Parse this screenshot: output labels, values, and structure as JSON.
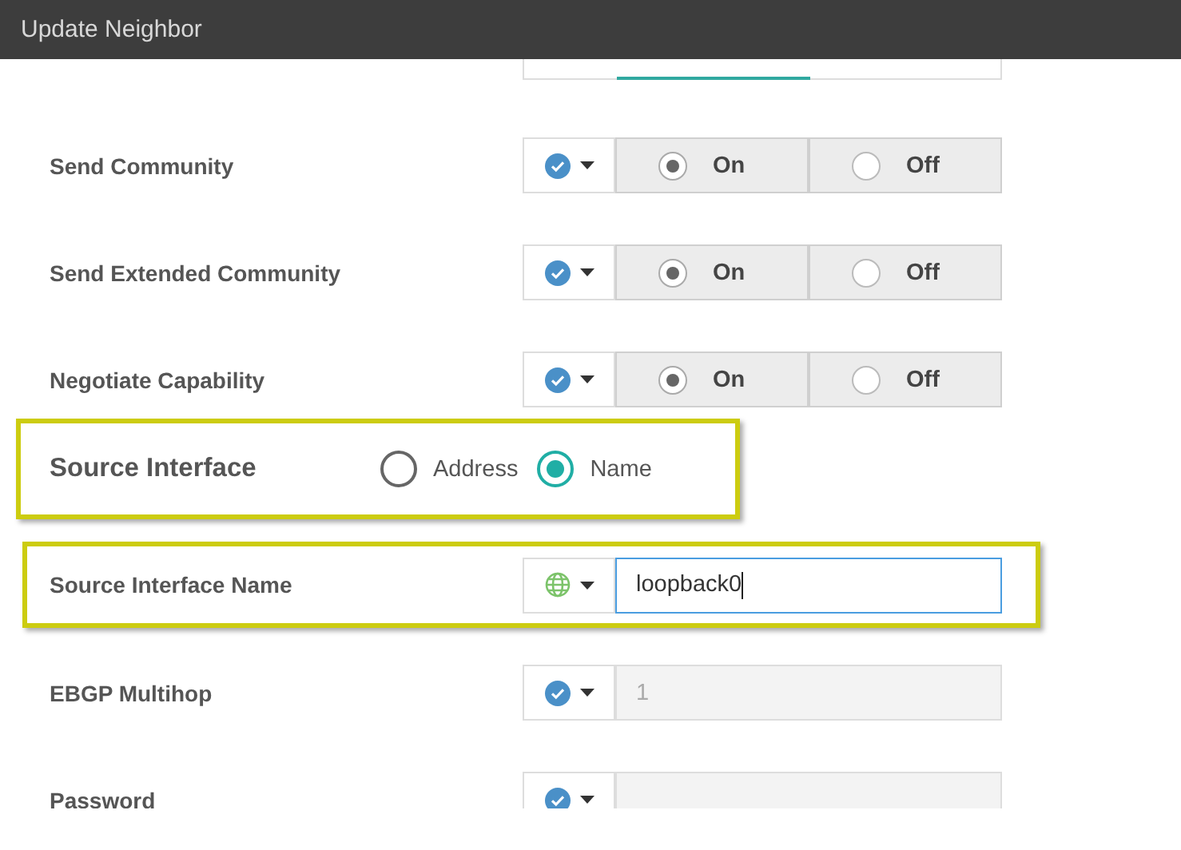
{
  "window": {
    "title": "Update Neighbor"
  },
  "rows": [
    {
      "kind": "cut_field"
    },
    {
      "kind": "toggle",
      "label": "Send Community",
      "mode": {
        "kind": "check"
      },
      "options": [
        {
          "label": "On",
          "selected": true
        },
        {
          "label": "Off",
          "selected": false
        }
      ]
    },
    {
      "kind": "toggle",
      "label": "Send Extended Community",
      "mode": {
        "kind": "check"
      },
      "options": [
        {
          "label": "On",
          "selected": true
        },
        {
          "label": "Off",
          "selected": false
        }
      ]
    },
    {
      "kind": "toggle",
      "label": "Negotiate Capability",
      "mode": {
        "kind": "check"
      },
      "options": [
        {
          "label": "On",
          "selected": true
        },
        {
          "label": "Off",
          "selected": false
        }
      ]
    },
    {
      "kind": "radio",
      "label": "Source Interface",
      "highlighted": true,
      "options": [
        {
          "label": "Address",
          "selected": false
        },
        {
          "label": "Name",
          "selected": true
        }
      ]
    },
    {
      "kind": "text",
      "label": "Source Interface Name",
      "highlighted": true,
      "mode": {
        "kind": "globe"
      },
      "value": "loopback0",
      "focused": true,
      "disabled": false
    },
    {
      "kind": "text",
      "label": "EBGP Multihop",
      "mode": {
        "kind": "check"
      },
      "value": "1",
      "focused": false,
      "disabled": true
    },
    {
      "kind": "text",
      "label": "Password",
      "mode": {
        "kind": "check"
      },
      "focused": false,
      "disabled": true
    }
  ]
}
